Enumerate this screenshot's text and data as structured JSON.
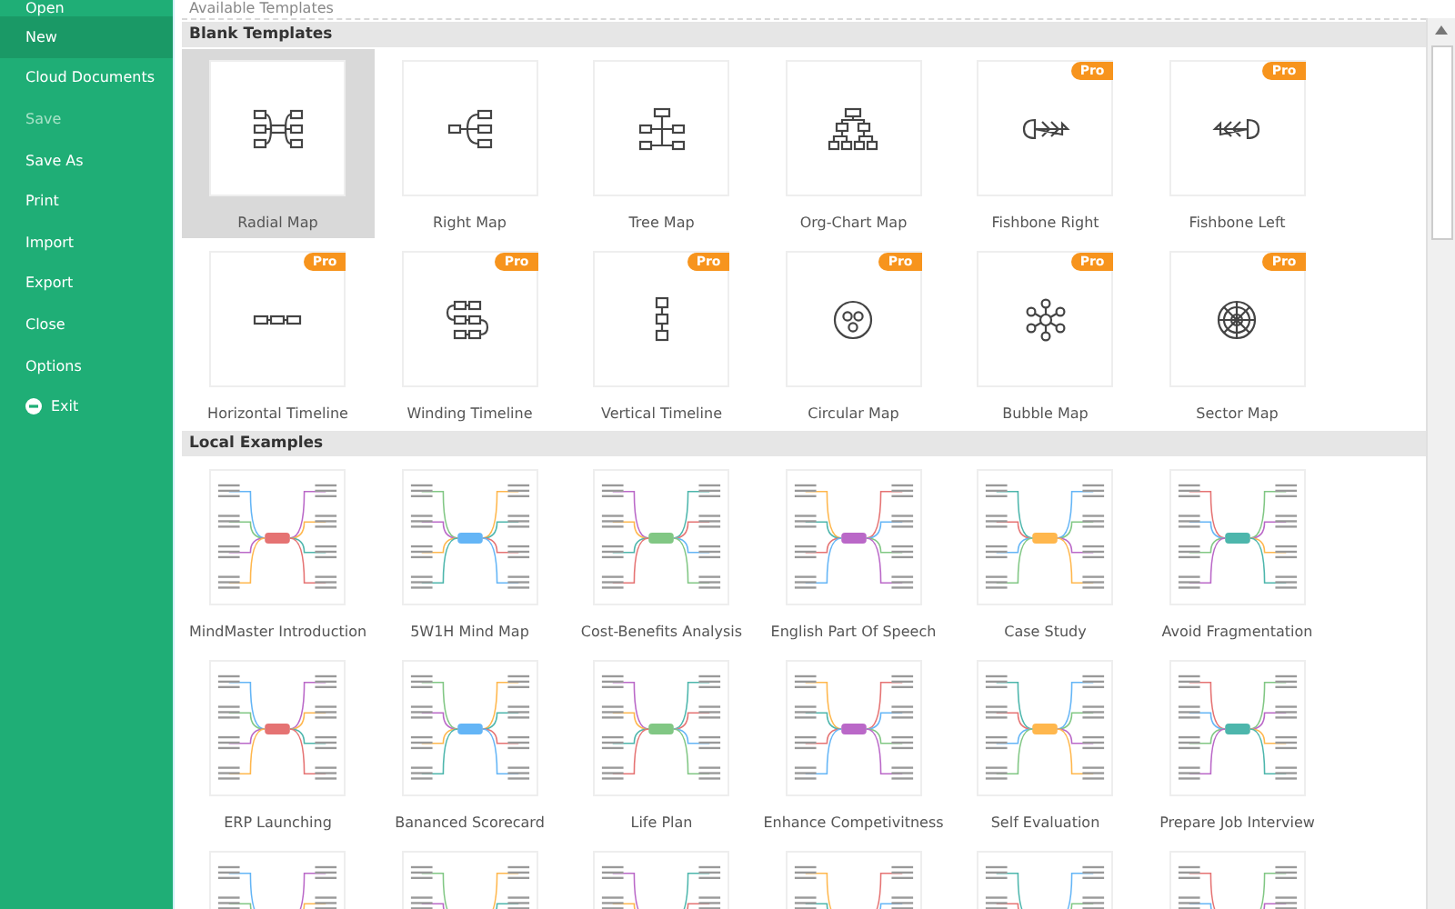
{
  "sidebar": {
    "items": [
      {
        "label": "Open",
        "selected": false,
        "disabled": false,
        "kind": "text"
      },
      {
        "label": "New",
        "selected": true,
        "disabled": false,
        "kind": "text"
      },
      {
        "label": "Cloud Documents",
        "selected": false,
        "disabled": false,
        "kind": "text"
      },
      {
        "label": "Save",
        "selected": false,
        "disabled": true,
        "kind": "text"
      },
      {
        "label": "Save As",
        "selected": false,
        "disabled": false,
        "kind": "text"
      },
      {
        "label": "Print",
        "selected": false,
        "disabled": false,
        "kind": "text"
      },
      {
        "label": "Import",
        "selected": false,
        "disabled": false,
        "kind": "text"
      },
      {
        "label": "Export",
        "selected": false,
        "disabled": false,
        "kind": "text"
      },
      {
        "label": "Close",
        "selected": false,
        "disabled": false,
        "kind": "text"
      },
      {
        "label": "Options",
        "selected": false,
        "disabled": false,
        "kind": "text"
      },
      {
        "label": "Exit",
        "selected": false,
        "disabled": false,
        "kind": "exit"
      }
    ]
  },
  "page_title": "Available Templates",
  "sections": [
    {
      "title": "Blank Templates",
      "items": [
        {
          "label": "Radial Map",
          "kind": "radial",
          "selected": true
        },
        {
          "label": "Right Map",
          "kind": "right",
          "selected": false
        },
        {
          "label": "Tree Map",
          "kind": "tree",
          "selected": false
        },
        {
          "label": "Org-Chart Map",
          "kind": "org",
          "selected": false
        },
        {
          "label": "Fishbone Right",
          "kind": "fish-right",
          "badge": "Pro",
          "selected": false
        },
        {
          "label": "Fishbone Left",
          "kind": "fish-left",
          "badge": "Pro",
          "selected": false
        },
        {
          "label": "Horizontal Timeline",
          "kind": "htime",
          "badge": "Pro",
          "selected": false
        },
        {
          "label": "Winding Timeline",
          "kind": "wind",
          "badge": "Pro",
          "selected": false
        },
        {
          "label": "Vertical Timeline",
          "kind": "vtime",
          "badge": "Pro",
          "selected": false
        },
        {
          "label": "Circular Map",
          "kind": "circular",
          "badge": "Pro",
          "selected": false
        },
        {
          "label": "Bubble Map",
          "kind": "bubble",
          "badge": "Pro",
          "selected": false
        },
        {
          "label": "Sector Map",
          "kind": "sector",
          "badge": "Pro",
          "selected": false
        }
      ]
    },
    {
      "title": "Local Examples",
      "items": [
        {
          "label": "MindMaster Introduction",
          "kind": "example",
          "selected": false
        },
        {
          "label": "5W1H Mind Map",
          "kind": "example",
          "selected": false
        },
        {
          "label": "Cost-Benefits Analysis",
          "kind": "example",
          "selected": false
        },
        {
          "label": "English Part Of Speech",
          "kind": "example",
          "selected": false
        },
        {
          "label": "Case Study",
          "kind": "example",
          "selected": false
        },
        {
          "label": "Avoid Fragmentation",
          "kind": "example",
          "selected": false
        },
        {
          "label": "ERP Launching",
          "kind": "example",
          "selected": false
        },
        {
          "label": "Bananced Scorecard",
          "kind": "example",
          "selected": false
        },
        {
          "label": "Life Plan",
          "kind": "example",
          "selected": false
        },
        {
          "label": "Enhance Competivitness",
          "kind": "example",
          "selected": false
        },
        {
          "label": "Self Evaluation",
          "kind": "example",
          "selected": false
        },
        {
          "label": "Prepare Job Interview",
          "kind": "example",
          "selected": false
        },
        {
          "kind": "example-cut",
          "selected": false
        },
        {
          "kind": "example-cut",
          "selected": false
        },
        {
          "kind": "example-cut",
          "selected": false
        },
        {
          "kind": "example-cut",
          "selected": false
        },
        {
          "kind": "example-cut",
          "selected": false
        },
        {
          "kind": "example-cut",
          "selected": false
        }
      ]
    }
  ]
}
